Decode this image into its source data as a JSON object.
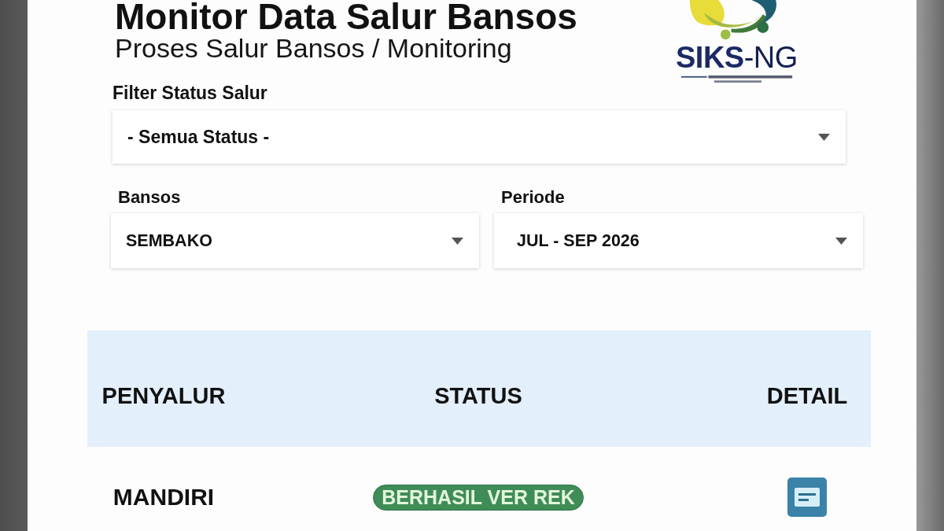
{
  "page": {
    "title": "Monitor Data Salur Bansos",
    "breadcrumb": "Proses Salur Bansos / Monitoring"
  },
  "logo": {
    "text": "**SIKS**-NG"
  },
  "filters": [
    {
      "label": "Filter Status Salur",
      "value": "- Semua Status -"
    },
    {
      "label": "Bansos",
      "value": "SEMBAKO"
    },
    {
      "label": "Periode",
      "value": "JUL - SEP 2026"
    }
  ],
  "table": {
    "columns": [
      "PENYALUR",
      "STATUS",
      "DETAIL"
    ],
    "rows": [
      {
        "penyalur": "MANDIRI",
        "status": "BERHASIL VER REK"
      }
    ]
  }
}
